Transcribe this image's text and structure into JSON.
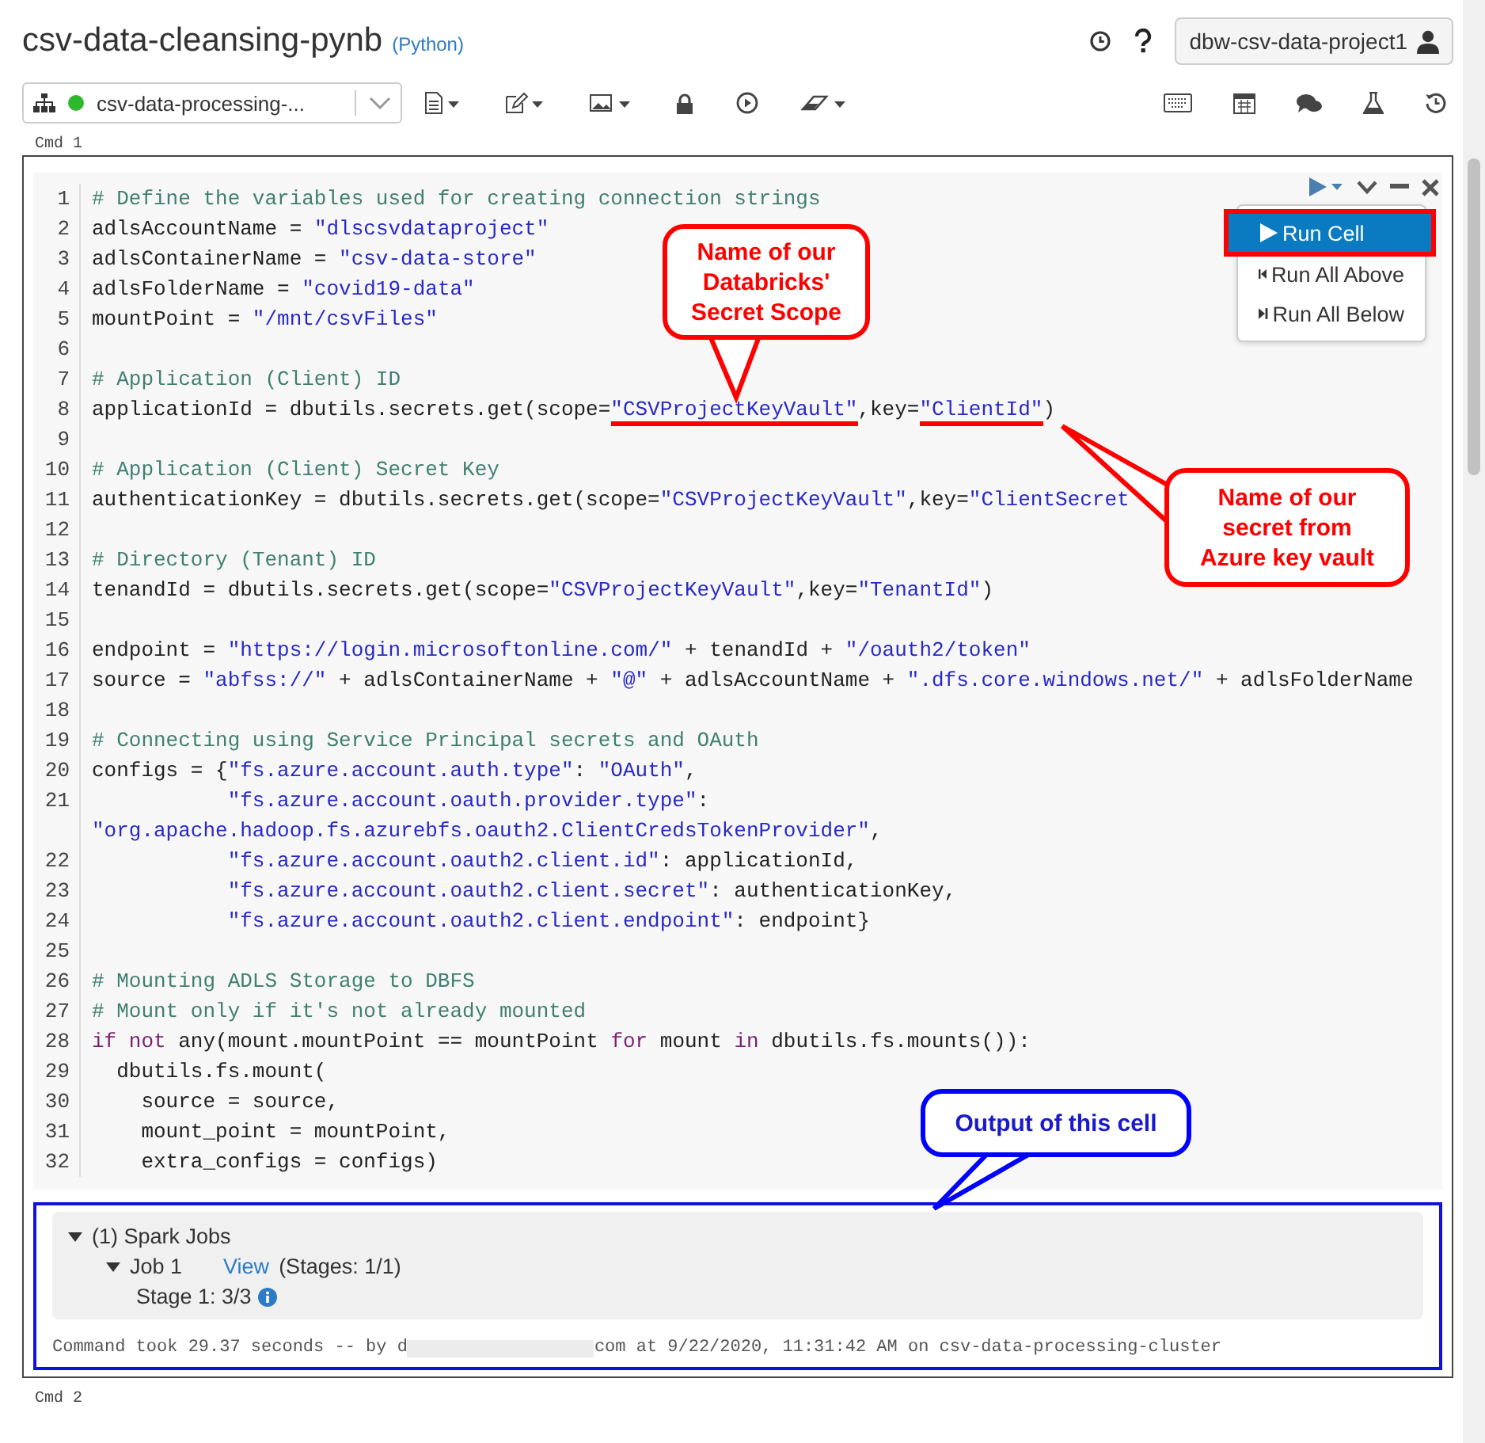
{
  "notebook": {
    "title": "csv-data-cleansing-pynb",
    "language": "(Python)"
  },
  "user": {
    "name": "dbw-csv-data-project1"
  },
  "cluster": {
    "name": "csv-data-processing-...",
    "running": true
  },
  "cell": {
    "label": "Cmd 1"
  },
  "run_menu": [
    {
      "label": "Run Cell",
      "selected": true,
      "kind": "current"
    },
    {
      "label": "Run All Above",
      "selected": false,
      "kind": "above"
    },
    {
      "label": "Run All Below",
      "selected": false,
      "kind": "below"
    }
  ],
  "code": [
    {
      "number": "1",
      "tokens": [
        {
          "kind": "comment",
          "text": "# Define the variables used for creating connection strings"
        }
      ]
    },
    {
      "number": "2",
      "tokens": [
        {
          "kind": "plain",
          "text": "adlsAccountName = "
        },
        {
          "kind": "string",
          "text": "\"dlscsvdataproject\""
        }
      ]
    },
    {
      "number": "3",
      "tokens": [
        {
          "kind": "plain",
          "text": "adlsContainerName = "
        },
        {
          "kind": "string",
          "text": "\"csv-data-store\""
        }
      ]
    },
    {
      "number": "4",
      "tokens": [
        {
          "kind": "plain",
          "text": "adlsFolderName = "
        },
        {
          "kind": "string",
          "text": "\"covid19-data\""
        }
      ]
    },
    {
      "number": "5",
      "tokens": [
        {
          "kind": "plain",
          "text": "mountPoint = "
        },
        {
          "kind": "string",
          "text": "\"/mnt/csvFiles\""
        }
      ]
    },
    {
      "number": "6"
    },
    {
      "number": "7",
      "tokens": [
        {
          "kind": "comment",
          "text": "# Application (Client) ID"
        }
      ]
    },
    {
      "number": "8",
      "tokens": [
        {
          "kind": "plain",
          "text": "applicationId = dbutils.secrets.get(scope="
        },
        {
          "kind": "string",
          "text": "\"CSVProjectKeyVault\"",
          "underlined": true
        },
        {
          "kind": "plain",
          "text": ",key="
        },
        {
          "kind": "string",
          "text": "\"ClientId\"",
          "underlined": true
        },
        {
          "kind": "plain",
          "text": ")"
        }
      ]
    },
    {
      "number": "9"
    },
    {
      "number": "10",
      "tokens": [
        {
          "kind": "comment",
          "text": "# Application (Client) Secret Key"
        }
      ]
    },
    {
      "number": "11",
      "tokens": [
        {
          "kind": "plain",
          "text": "authenticationKey = dbutils.secrets.get(scope="
        },
        {
          "kind": "string",
          "text": "\"CSVProjectKeyVault\""
        },
        {
          "kind": "plain",
          "text": ",key="
        },
        {
          "kind": "string",
          "text": "\"ClientSecret"
        }
      ]
    },
    {
      "number": "12"
    },
    {
      "number": "13",
      "tokens": [
        {
          "kind": "comment",
          "text": "# Directory (Tenant) ID"
        }
      ]
    },
    {
      "number": "14",
      "tokens": [
        {
          "kind": "plain",
          "text": "tenandId = dbutils.secrets.get(scope="
        },
        {
          "kind": "string",
          "text": "\"CSVProjectKeyVault\""
        },
        {
          "kind": "plain",
          "text": ",key="
        },
        {
          "kind": "string",
          "text": "\"TenantId\""
        },
        {
          "kind": "plain",
          "text": ")"
        }
      ]
    },
    {
      "number": "15"
    },
    {
      "number": "16",
      "tokens": [
        {
          "kind": "plain",
          "text": "endpoint = "
        },
        {
          "kind": "string",
          "text": "\"https://login.microsoftonline.com/\""
        },
        {
          "kind": "plain",
          "text": " + tenandId + "
        },
        {
          "kind": "string",
          "text": "\"/oauth2/token\""
        }
      ]
    },
    {
      "number": "17",
      "tokens": [
        {
          "kind": "plain",
          "text": "source = "
        },
        {
          "kind": "string",
          "text": "\"abfss://\""
        },
        {
          "kind": "plain",
          "text": " + adlsContainerName + "
        },
        {
          "kind": "string",
          "text": "\"@\""
        },
        {
          "kind": "plain",
          "text": " + adlsAccountName + "
        },
        {
          "kind": "string",
          "text": "\".dfs.core.windows.net/\""
        },
        {
          "kind": "plain",
          "text": " + adlsFolderName"
        }
      ]
    },
    {
      "number": "18"
    },
    {
      "number": "19",
      "tokens": [
        {
          "kind": "comment",
          "text": "# Connecting using Service Principal secrets and OAuth"
        }
      ]
    },
    {
      "number": "20",
      "tokens": [
        {
          "kind": "plain",
          "text": "configs = {"
        },
        {
          "kind": "string",
          "text": "\"fs.azure.account.auth.type\""
        },
        {
          "kind": "plain",
          "text": ": "
        },
        {
          "kind": "string",
          "text": "\"OAuth\""
        },
        {
          "kind": "plain",
          "text": ","
        }
      ]
    },
    {
      "number": "21",
      "tokens": [
        {
          "kind": "string",
          "text": "           \"fs.azure.account.oauth.provider.type\""
        },
        {
          "kind": "plain",
          "text": ":"
        }
      ],
      "continuation": [
        {
          "kind": "string",
          "text": "\"org.apache.hadoop.fs.azurebfs.oauth2.ClientCredsTokenProvider\""
        },
        {
          "kind": "plain",
          "text": ","
        }
      ]
    },
    {
      "number": "22",
      "tokens": [
        {
          "kind": "string",
          "text": "           \"fs.azure.account.oauth2.client.id\""
        },
        {
          "kind": "plain",
          "text": ": applicationId,"
        }
      ]
    },
    {
      "number": "23",
      "tokens": [
        {
          "kind": "string",
          "text": "           \"fs.azure.account.oauth2.client.secret\""
        },
        {
          "kind": "plain",
          "text": ": authenticationKey,"
        }
      ]
    },
    {
      "number": "24",
      "tokens": [
        {
          "kind": "string",
          "text": "           \"fs.azure.account.oauth2.client.endpoint\""
        },
        {
          "kind": "plain",
          "text": ": endpoint}"
        }
      ]
    },
    {
      "number": "25"
    },
    {
      "number": "26",
      "tokens": [
        {
          "kind": "comment",
          "text": "# Mounting ADLS Storage to DBFS"
        }
      ]
    },
    {
      "number": "27",
      "tokens": [
        {
          "kind": "comment",
          "text": "# Mount only if it's not already mounted"
        }
      ]
    },
    {
      "number": "28",
      "tokens": [
        {
          "kind": "keyword",
          "text": "if"
        },
        {
          "kind": "keyword",
          "text": " not"
        },
        {
          "kind": "plain",
          "text": " any(mount.mountPoint == mountPoint "
        },
        {
          "kind": "keyword",
          "text": "for"
        },
        {
          "kind": "plain",
          "text": " mount "
        },
        {
          "kind": "keyword",
          "text": "in"
        },
        {
          "kind": "plain",
          "text": " dbutils.fs.mounts()):"
        }
      ]
    },
    {
      "number": "29",
      "tokens": [
        {
          "kind": "plain",
          "text": "  dbutils.fs.mount("
        }
      ]
    },
    {
      "number": "30",
      "tokens": [
        {
          "kind": "plain",
          "text": "    source = source,"
        }
      ]
    },
    {
      "number": "31",
      "tokens": [
        {
          "kind": "plain",
          "text": "    mount_point = mountPoint,"
        }
      ]
    },
    {
      "number": "32",
      "tokens": [
        {
          "kind": "plain",
          "text": "    extra_configs = configs)"
        }
      ]
    }
  ],
  "output": {
    "spark_jobs": {
      "label": "(1) Spark Jobs",
      "expanded": true,
      "jobs": [
        {
          "label": "Job 1",
          "expanded": true,
          "link": "View",
          "stages": "(Stages: 1/1)",
          "children": [
            {
              "label": "Stage 1: 3/3"
            }
          ]
        }
      ]
    },
    "command": {
      "before": "Command took 29.37 seconds -- by d",
      "after": "com at 9/22/2020, 11:31:42 AM on csv-data-processing-cluster"
    }
  },
  "next_cell": {
    "label": "Cmd 2"
  },
  "callouts": [
    {
      "text": "Name of our Databricks' Secret Scope",
      "color": "#ff0000"
    },
    {
      "text": "Name of our secret from Azure key vault",
      "color": "#ff0000"
    },
    {
      "text": "Output of this cell",
      "color": "#0000ff"
    }
  ]
}
